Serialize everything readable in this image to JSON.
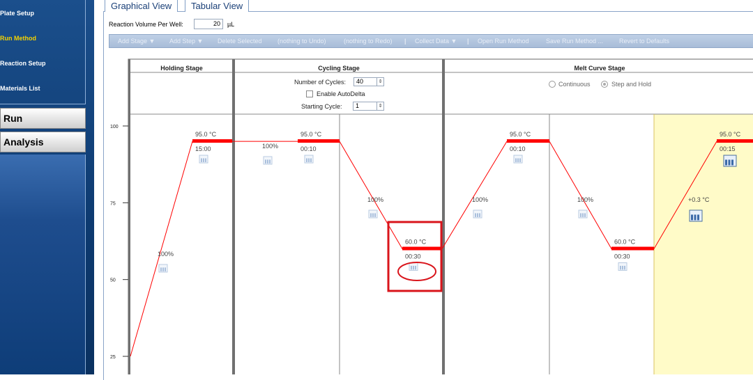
{
  "sidebar": {
    "setup_items": [
      {
        "label": "Plate Setup",
        "active": false
      },
      {
        "label": "Run Method",
        "active": true
      },
      {
        "label": "Reaction Setup",
        "active": false
      },
      {
        "label": "Materials List",
        "active": false
      }
    ],
    "nav_buttons": [
      "Run",
      "Analysis"
    ]
  },
  "tabs": [
    {
      "label": "Graphical View",
      "active": true
    },
    {
      "label": "Tabular View",
      "active": false
    }
  ],
  "reaction_volume": {
    "label": "Reaction Volume Per Well:",
    "value": "20",
    "unit": "µL"
  },
  "toolbar": {
    "add_stage": "Add Stage ▼",
    "add_step": "Add Step ▼",
    "delete_selected": "Delete Selected",
    "undo": "(nothing to Undo)",
    "redo": "(nothing to Redo)",
    "collect_data": "Collect Data ▼",
    "open_run_method": "Open Run Method",
    "save_run_method": "Save Run Method ...",
    "revert": "Revert to Defaults",
    "sep": "|"
  },
  "stages": {
    "holding": {
      "title": "Holding Stage"
    },
    "cycling": {
      "title": "Cycling Stage",
      "num_cycles_label": "Number of Cycles:",
      "num_cycles": "40",
      "enable_autodelta": "Enable AutoDelta",
      "starting_cycle_label": "Starting Cycle:",
      "starting_cycle": "1"
    },
    "melt": {
      "title": "Melt Curve Stage",
      "continuous": "Continuous",
      "step_and_hold": "Step and Hold",
      "mode": "step_and_hold"
    }
  },
  "y_axis": {
    "ticks": [
      "100",
      "75",
      "50",
      "25"
    ]
  },
  "steps": [
    {
      "ramp": "100%",
      "temp": "95.0 °C",
      "time": "15:00",
      "temp_value": 95.0
    },
    {
      "ramp": "100%",
      "temp": "95.0 °C",
      "time": "00:10",
      "temp_value": 95.0
    },
    {
      "ramp": "100%",
      "temp": "60.0 °C",
      "time": "00:30",
      "temp_value": 60.0
    },
    {
      "ramp": "100%",
      "temp": "95.0 °C",
      "time": "00:10",
      "temp_value": 95.0
    },
    {
      "ramp": "100%",
      "temp": "60.0 °C",
      "time": "00:30",
      "temp_value": 60.0
    },
    {
      "ramp": "+0.3 °C",
      "temp": "95.0 °C",
      "time": "00:15",
      "temp_value": 95.0
    }
  ],
  "colors": {
    "profile": "#ff0000",
    "highlight": "#fffbc8",
    "annotation": "#d9141b"
  }
}
